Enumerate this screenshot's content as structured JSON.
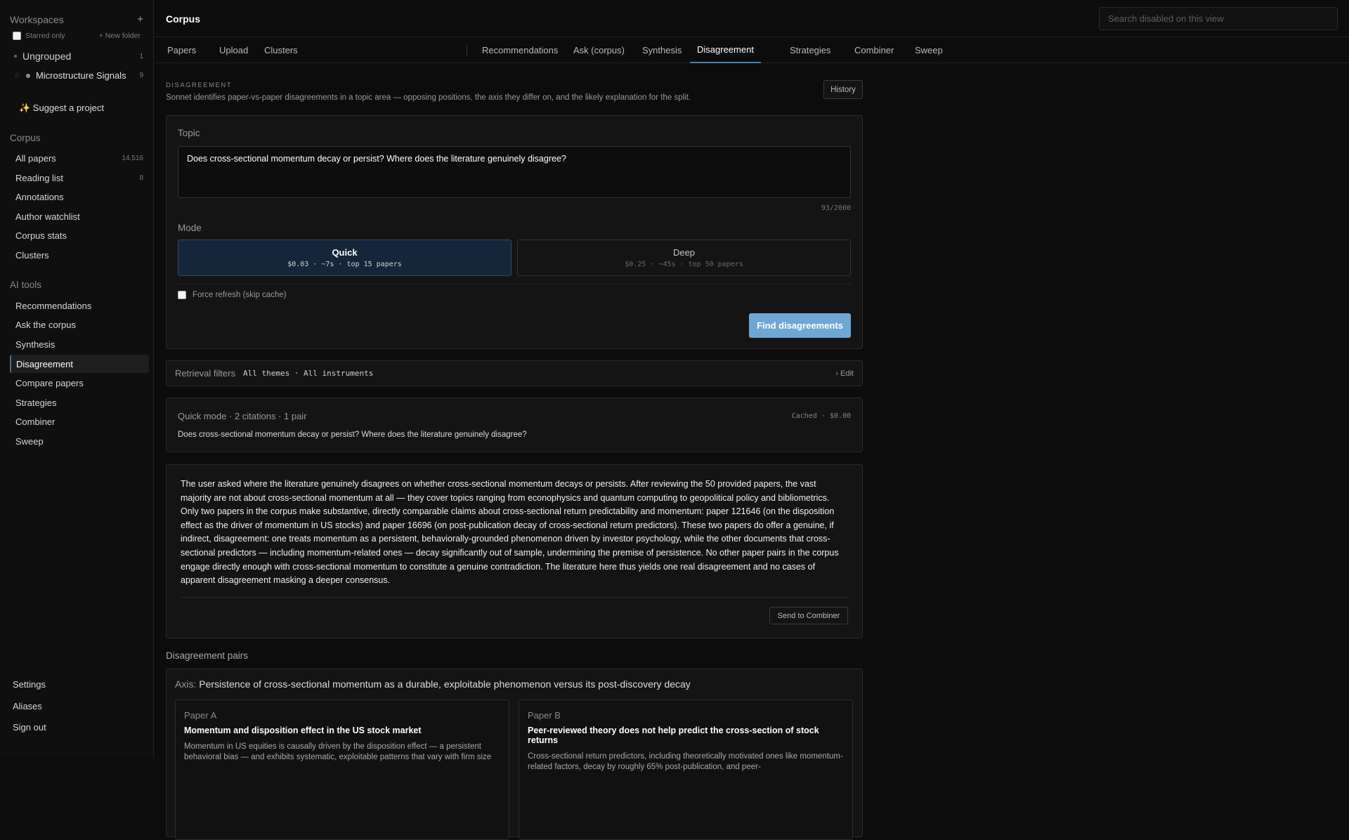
{
  "sidebar": {
    "workspaces_label": "Workspaces",
    "add_icon": "+",
    "starred_only": "Starred only",
    "new_folder": "+ New folder",
    "folders": [
      {
        "name": "Ungrouped",
        "count": "1"
      },
      {
        "name": "Microstructure Signals",
        "count": "9"
      }
    ],
    "suggest": "✨ Suggest a project",
    "corpus_label": "Corpus",
    "corpus_items": [
      {
        "label": "All papers",
        "count": "14,516"
      },
      {
        "label": "Reading list",
        "count": "8"
      },
      {
        "label": "Annotations",
        "count": ""
      },
      {
        "label": "Author watchlist",
        "count": ""
      },
      {
        "label": "Corpus stats",
        "count": ""
      },
      {
        "label": "Clusters",
        "count": ""
      }
    ],
    "ai_label": "AI tools",
    "ai_items": [
      {
        "label": "Recommendations"
      },
      {
        "label": "Ask the corpus"
      },
      {
        "label": "Synthesis"
      },
      {
        "label": "Disagreement"
      },
      {
        "label": "Compare papers"
      },
      {
        "label": "Strategies"
      },
      {
        "label": "Combiner"
      },
      {
        "label": "Sweep"
      }
    ],
    "footer": [
      "Settings",
      "Aliases",
      "Sign out"
    ]
  },
  "header": {
    "title": "Corpus",
    "search_placeholder": "Search disabled on this view"
  },
  "tabs": [
    "Papers",
    "Upload",
    "Clusters",
    "Recommendations",
    "Ask (corpus)",
    "Synthesis",
    "Disagreement",
    "Strategies",
    "Combiner",
    "Sweep"
  ],
  "active_tab": "Disagreement",
  "page": {
    "eyebrow": "DISAGREEMENT",
    "description": "Sonnet identifies paper-vs-paper disagreements in a topic area — opposing positions, the axis they differ on, and the likely explanation for the split.",
    "history_button": "History",
    "topic_label": "Topic",
    "topic_value": "Does cross-sectional momentum decay or persist? Where does the literature genuinely disagree?",
    "counter": "93/2000",
    "mode_label": "Mode",
    "modes": [
      {
        "title": "Quick",
        "sub": "$0.03 · ~7s · top 15 papers",
        "selected": true
      },
      {
        "title": "Deep",
        "sub": "$0.25 · ~45s · top 50 papers",
        "selected": false
      }
    ],
    "force_refresh": "Force refresh (skip cache)",
    "find_button": "Find disagreements",
    "filters_label": "Retrieval filters",
    "filters_value": "All themes · All instruments",
    "filters_edit": "› Edit",
    "summary_meta": "Quick mode · 2 citations · 1 pair",
    "summary_cache": "Cached · $0.00",
    "summary_question": "Does cross-sectional momentum decay or persist? Where does the literature genuinely disagree?",
    "result_text": "The user asked where the literature genuinely disagrees on whether cross-sectional momentum decays or persists. After reviewing the 50 provided papers, the vast majority are not about cross-sectional momentum at all — they cover topics ranging from econophysics and quantum computing to geopolitical policy and bibliometrics. Only two papers in the corpus make substantive, directly comparable claims about cross-sectional return predictability and momentum: paper 121646 (on the disposition effect as the driver of momentum in US stocks) and paper 16696 (on post-publication decay of cross-sectional return predictors). These two papers do offer a genuine, if indirect, disagreement: one treats momentum as a persistent, behaviorally-grounded phenomenon driven by investor psychology, while the other documents that cross-sectional predictors — including momentum-related ones — decay significantly out of sample, undermining the premise of persistence. No other paper pairs in the corpus engage directly enough with cross-sectional momentum to constitute a genuine contradiction. The literature here thus yields one real disagreement and no cases of apparent disagreement masking a deeper consensus.",
    "send_button": "Send to Combiner",
    "pairs_title": "Disagreement pairs",
    "axis_key": "Axis:",
    "axis_value": "Persistence of cross-sectional momentum as a durable, exploitable phenomenon versus its post-discovery decay",
    "paper_a": {
      "label": "Paper A",
      "title": "Momentum and disposition effect in the US stock market",
      "body": "Momentum in US equities is causally driven by the disposition effect — a persistent behavioral bias — and exhibits systematic, exploitable patterns that vary with firm size"
    },
    "paper_b": {
      "label": "Paper B",
      "title": "Peer-reviewed theory does not help predict the cross-section of stock returns",
      "body": "Cross-sectional return predictors, including theoretically motivated ones like momentum-related factors, decay by roughly 65% post-publication, and peer-"
    }
  }
}
